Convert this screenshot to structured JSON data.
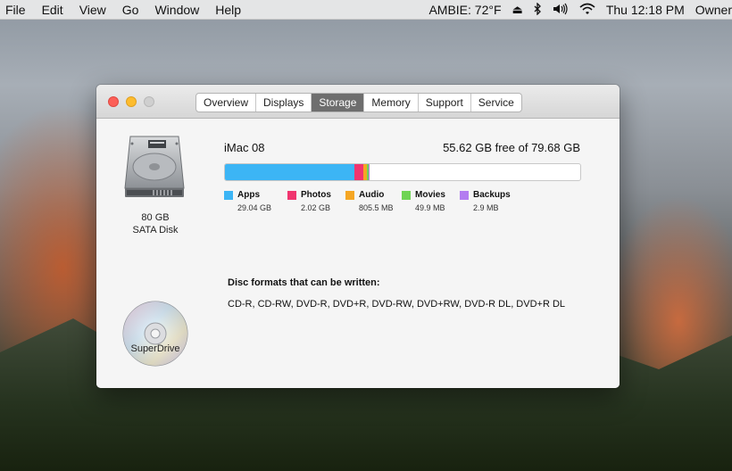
{
  "menubar": {
    "items": [
      "File",
      "Edit",
      "View",
      "Go",
      "Window",
      "Help"
    ],
    "status": {
      "ambie": "AMBIE: 72°F",
      "clock": "Thu 12:18 PM",
      "user": "Owner"
    },
    "icons": [
      "eject-icon",
      "bluetooth-icon",
      "volume-icon",
      "wifi-icon"
    ]
  },
  "window": {
    "tabs": [
      "Overview",
      "Displays",
      "Storage",
      "Memory",
      "Support",
      "Service"
    ],
    "active_tab": "Storage",
    "disk": {
      "size": "80 GB",
      "type": "SATA Disk"
    },
    "volume": {
      "name": "iMac 08",
      "free": "55.62 GB free of 79.68 GB"
    },
    "usage": [
      {
        "label": "Apps",
        "size": "29.04 GB",
        "color": "#3cb5f5",
        "fraction": 0.3645
      },
      {
        "label": "Photos",
        "size": "2.02 GB",
        "color": "#f0356f",
        "fraction": 0.0253
      },
      {
        "label": "Audio",
        "size": "805.5 MB",
        "color": "#f5a623",
        "fraction": 0.0101
      },
      {
        "label": "Movies",
        "size": "49.9 MB",
        "color": "#6fd454",
        "fraction": 0.0006
      },
      {
        "label": "Backups",
        "size": "2.9 MB",
        "color": "#b37cf0",
        "fraction": 4e-05
      }
    ],
    "drive": {
      "label": "SuperDrive"
    },
    "disc_formats": {
      "heading": "Disc formats that can be written:",
      "list": "CD-R, CD-RW, DVD-R, DVD+R, DVD-RW, DVD+RW, DVD-R DL, DVD+R DL"
    }
  }
}
